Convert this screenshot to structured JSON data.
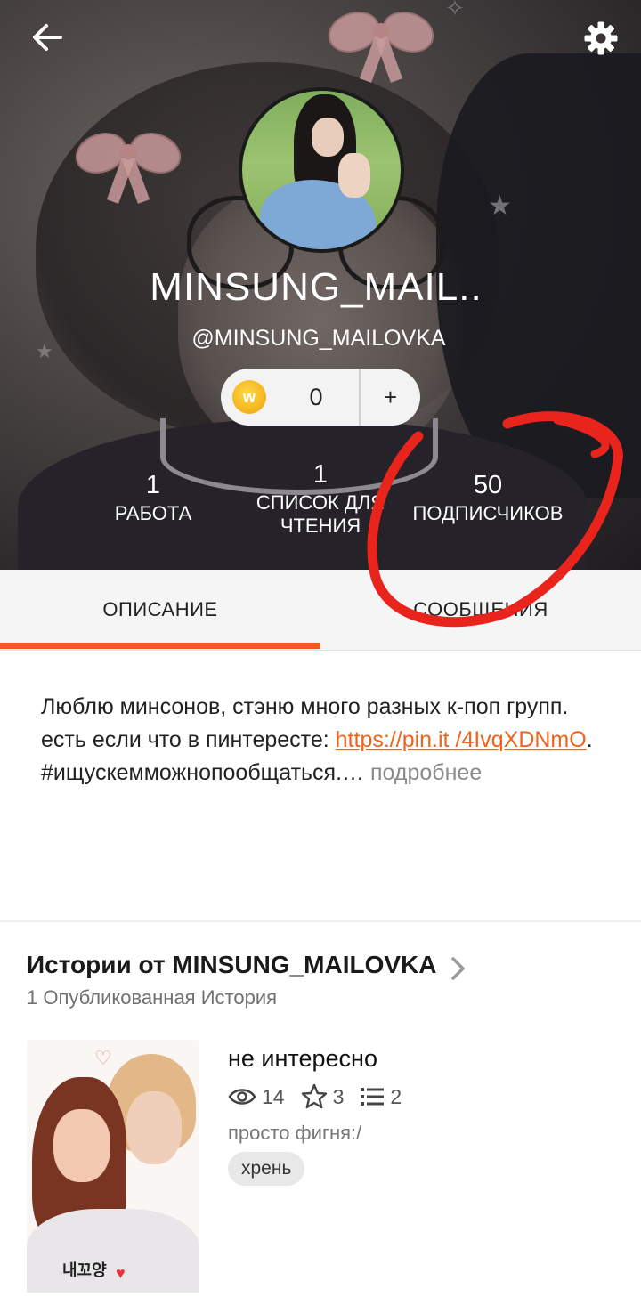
{
  "profile": {
    "display_name": "MINSUNG_MAIL..",
    "handle": "@MINSUNG_MAILOVKA",
    "coins": {
      "icon": "w-coin-icon",
      "icon_letter": "w",
      "count": "0",
      "add_label": "+"
    },
    "stats": {
      "works": {
        "value": "1",
        "label": "РАБОТА"
      },
      "reading_lists": {
        "value": "1",
        "label_line1": "СПИСОК ДЛЯ",
        "label_line2": "ЧТЕНИЯ"
      },
      "followers": {
        "value": "50",
        "label": "ПОДПИСЧИКОВ"
      }
    },
    "annotation_color": "#e8241c"
  },
  "tabs": {
    "description": "ОПИСАНИЕ",
    "messages": "СООБЩЕНИЯ",
    "active": "description",
    "accent_color": "#f05a1a"
  },
  "description": {
    "line1": "Люблю минсонов, стэню много разных к-поп групп.",
    "line2": "есть если что в пинтересте: ",
    "link": "https://pin.it /4IvqXDNmO",
    "line2_end": ".",
    "line3": "#ищускемможнопообщаться.…",
    "more": "подробнее"
  },
  "stories": {
    "title": "Истории от MINSUNG_MAILOVKA",
    "subtitle": "1 Опубликованная История",
    "items": [
      {
        "title": "не интересно",
        "views": "14",
        "votes": "3",
        "parts": "2",
        "blurb": "просто фигня:/",
        "tag": "хрень",
        "cover_text": "내꼬양"
      }
    ]
  },
  "icons": {
    "back": "arrow-left-icon",
    "settings": "gear-icon",
    "views": "eye-icon",
    "votes": "star-icon",
    "parts": "list-icon",
    "chevron": "chevron-right-icon"
  }
}
